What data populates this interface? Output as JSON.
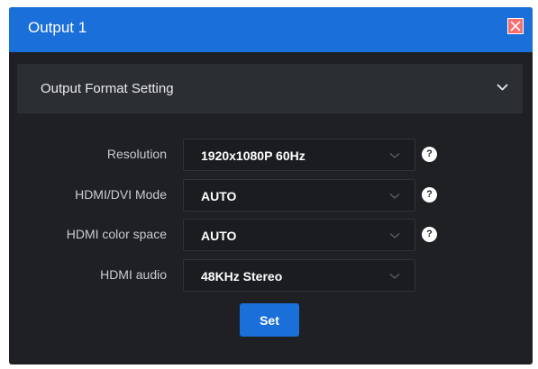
{
  "window": {
    "title": "Output 1",
    "close_icon": "close-icon"
  },
  "section": {
    "title": "Output Format Setting",
    "toggle_icon": "chevron-down-icon"
  },
  "fields": [
    {
      "label": "Resolution",
      "value": "1920x1080P 60Hz",
      "has_help": true
    },
    {
      "label": "HDMI/DVI Mode",
      "value": "AUTO",
      "has_help": true
    },
    {
      "label": "HDMI color space",
      "value": "AUTO",
      "has_help": true
    },
    {
      "label": "HDMI audio",
      "value": "48KHz Stereo",
      "has_help": false
    }
  ],
  "help_glyph": "?",
  "actions": {
    "set_label": "Set"
  },
  "colors": {
    "accent": "#1a6fd8",
    "panel": "#1e2023",
    "section": "#2b2e33",
    "close": "#f56f6f"
  }
}
